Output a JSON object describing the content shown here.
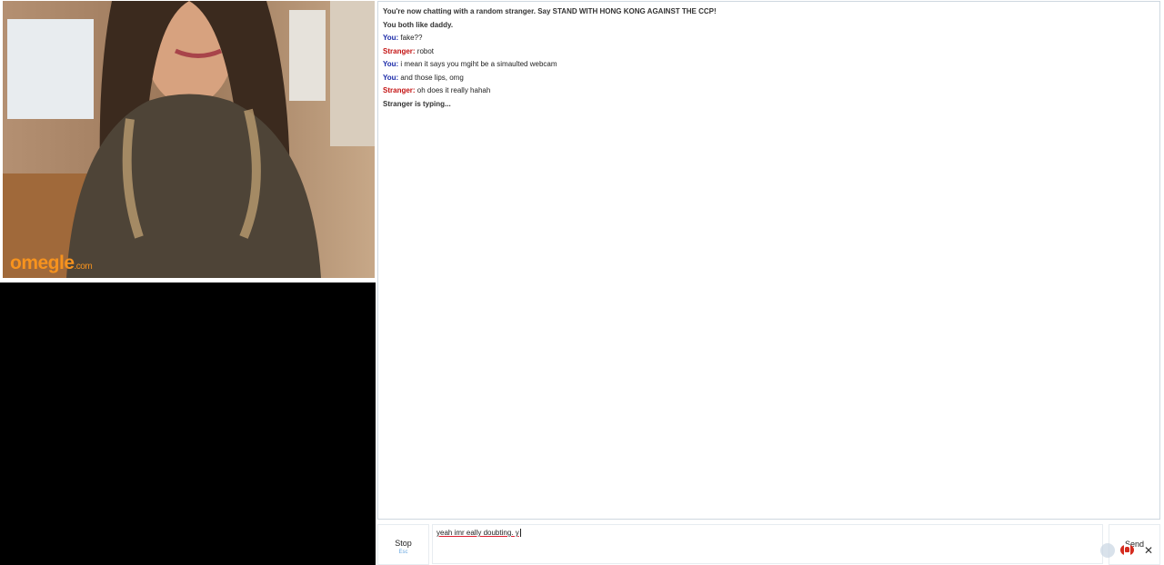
{
  "logo": {
    "text": "omegle",
    "suffix": ".com"
  },
  "chat": {
    "status_lines": [
      "You're now chatting with a random stranger. Say STAND WITH HONG KONG AGAINST THE CCP!",
      "You both like daddy."
    ],
    "messages": [
      {
        "speaker": "You:",
        "text": "fake??"
      },
      {
        "speaker": "Stranger:",
        "text": "robot"
      },
      {
        "speaker": "You:",
        "text": "i mean it says you mgiht be a simaulted webcam"
      },
      {
        "speaker": "You:",
        "text": "and those lips, omg"
      },
      {
        "speaker": "Stranger:",
        "text": "oh does it really hahah"
      }
    ],
    "typing_status": "Stranger is typing..."
  },
  "controls": {
    "stop_label": "Stop",
    "stop_hint": "Esc",
    "input_value": "yeah imr eally doubting. y",
    "send_label": "Send"
  },
  "icons": {
    "flag": "canada-flag-icon",
    "close": "close-icon",
    "close_glyph": "✕"
  },
  "colors": {
    "you": "#1a2aa8",
    "stranger": "#c41414",
    "logo": "#f7931e"
  }
}
